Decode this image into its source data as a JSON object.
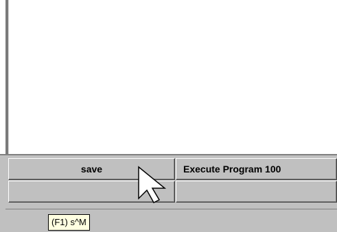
{
  "button_grid": {
    "save_label": "save",
    "execute_label": "Execute Program 100",
    "empty_1_label": "",
    "empty_2_label": ""
  },
  "tooltip": {
    "text": "(F1) s^M"
  },
  "icons": {
    "cursor": "mouse-pointer-icon"
  }
}
